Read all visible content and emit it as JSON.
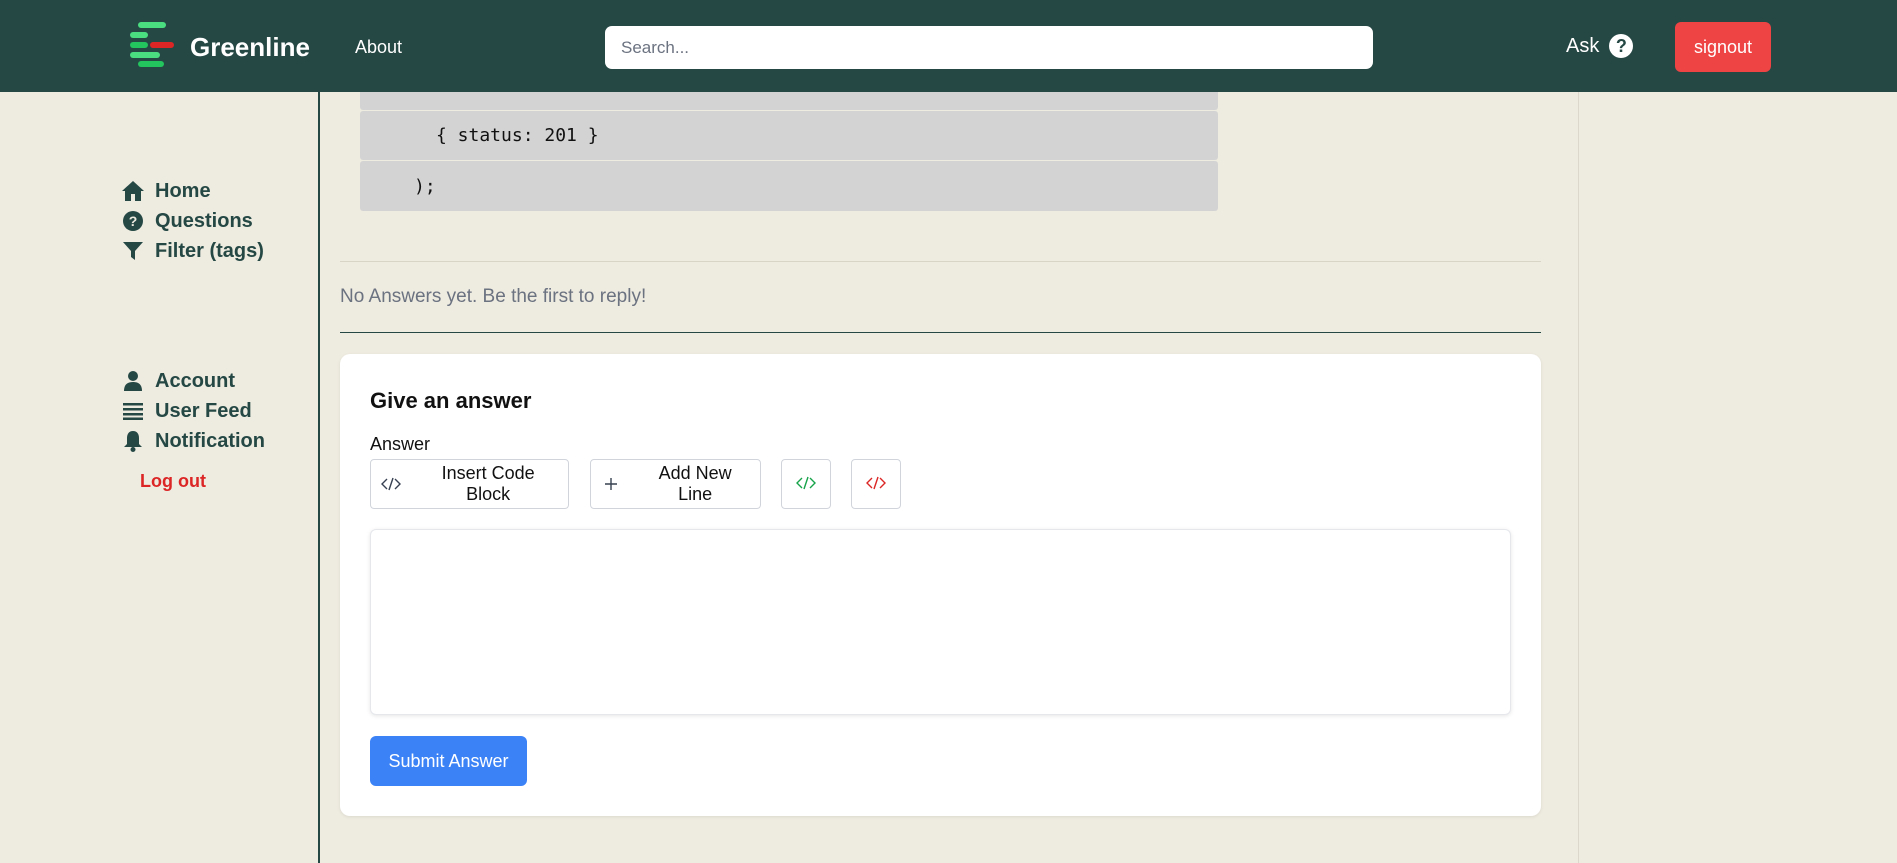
{
  "header": {
    "brand": "Greenline",
    "about_label": "About",
    "search_placeholder": "Search...",
    "ask_label": "Ask",
    "ask_icon": "?",
    "signout_label": "signout"
  },
  "sidebar": {
    "primary_items": [
      {
        "label": "Home",
        "icon": "home-icon"
      },
      {
        "label": "Questions",
        "icon": "question-circle-icon"
      },
      {
        "label": "Filter (tags)",
        "icon": "filter-icon"
      }
    ],
    "secondary_items": [
      {
        "label": "Account",
        "icon": "user-icon"
      },
      {
        "label": "User Feed",
        "icon": "list-icon"
      },
      {
        "label": "Notification",
        "icon": "bell-icon"
      }
    ],
    "logout_label": "Log out"
  },
  "code_block": {
    "lines": [
      "{ status: 201 }",
      ");"
    ]
  },
  "answers": {
    "empty_message": "No Answers yet. Be the first to reply!"
  },
  "answer_form": {
    "title": "Give an answer",
    "answer_label": "Answer",
    "insert_code_label": "Insert Code Block",
    "add_line_label": "Add New Line",
    "submit_label": "Submit Answer"
  },
  "colors": {
    "header_bg": "#254845",
    "page_bg": "#eeebe0",
    "signout_bg": "#ef4444",
    "submit_bg": "#3b82f6",
    "logout_text": "#dc2626"
  }
}
